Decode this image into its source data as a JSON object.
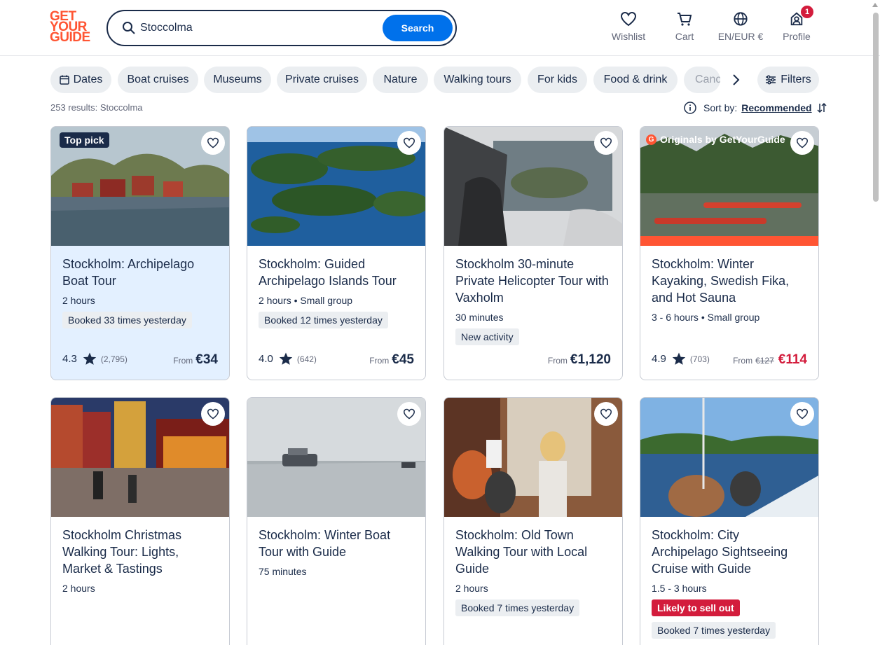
{
  "header": {
    "logo_lines": [
      "GET",
      "YOUR",
      "GUIDE"
    ],
    "search_value": "Stoccolma",
    "search_button": "Search",
    "nav": [
      {
        "label": "Wishlist",
        "icon": "heart-icon"
      },
      {
        "label": "Cart",
        "icon": "cart-icon"
      },
      {
        "label": "EN/EUR €",
        "icon": "globe-icon"
      },
      {
        "label": "Profile",
        "icon": "profile-icon",
        "badge": "1"
      }
    ]
  },
  "filters": {
    "dates": "Dates",
    "chips": [
      "Boat cruises",
      "Museums",
      "Private cruises",
      "Nature",
      "Walking tours",
      "For kids",
      "Food & drink",
      "Canc"
    ],
    "filters_label": "Filters"
  },
  "results": {
    "count_text": "253 results: Stoccolma",
    "sort_label": "Sort by:",
    "sort_value": "Recommended"
  },
  "colors": {
    "brand": "#ff5533",
    "primary": "#0071eb",
    "text": "#1a2b49",
    "sale": "#d31c3c"
  },
  "cards": [
    {
      "tag": "Top pick",
      "title": "Stockholm: Archipelago Boat Tour",
      "meta": "2 hours",
      "pills": [
        "Booked 33 times yesterday"
      ],
      "rating": "4.3",
      "reviews": "(2,795)",
      "from": "From",
      "old_price": "",
      "price": "€34"
    },
    {
      "title": "Stockholm: Guided Archipelago Islands Tour",
      "meta": "2 hours • Small group",
      "pills": [
        "Booked 12 times yesterday"
      ],
      "rating": "4.0",
      "reviews": "(642)",
      "from": "From",
      "old_price": "",
      "price": "€45"
    },
    {
      "title": "Stockholm 30-minute Private Helicopter Tour with Vaxholm",
      "meta": "30 minutes",
      "pills": [
        "New activity"
      ],
      "rating": "",
      "reviews": "",
      "from": "From",
      "old_price": "",
      "price": "€1,120"
    },
    {
      "tag_originals": "Originals by GetYourGuide",
      "originals_g": "G",
      "title": "Stockholm: Winter Kayaking, Swedish Fika, and Hot Sauna",
      "meta": "3 - 6 hours • Small group",
      "pills": [],
      "rating": "4.9",
      "reviews": "(703)",
      "from": "From",
      "old_price": "€127",
      "price": "€114"
    },
    {
      "title": "Stockholm Christmas Walking Tour: Lights, Market & Tastings",
      "meta": "2 hours",
      "pills": []
    },
    {
      "title": "Stockholm: Winter Boat Tour with Guide",
      "meta": "75 minutes",
      "pills": []
    },
    {
      "title": "Stockholm: Old Town Walking Tour with Local Guide",
      "meta": "2 hours",
      "pills": [
        "Booked 7 times yesterday"
      ]
    },
    {
      "title": "Stockholm: City Archipelago Sightseeing Cruise with Guide",
      "meta": "1.5 - 3 hours",
      "pills": [
        "Likely to sell out",
        "Booked 7 times yesterday"
      ]
    }
  ]
}
